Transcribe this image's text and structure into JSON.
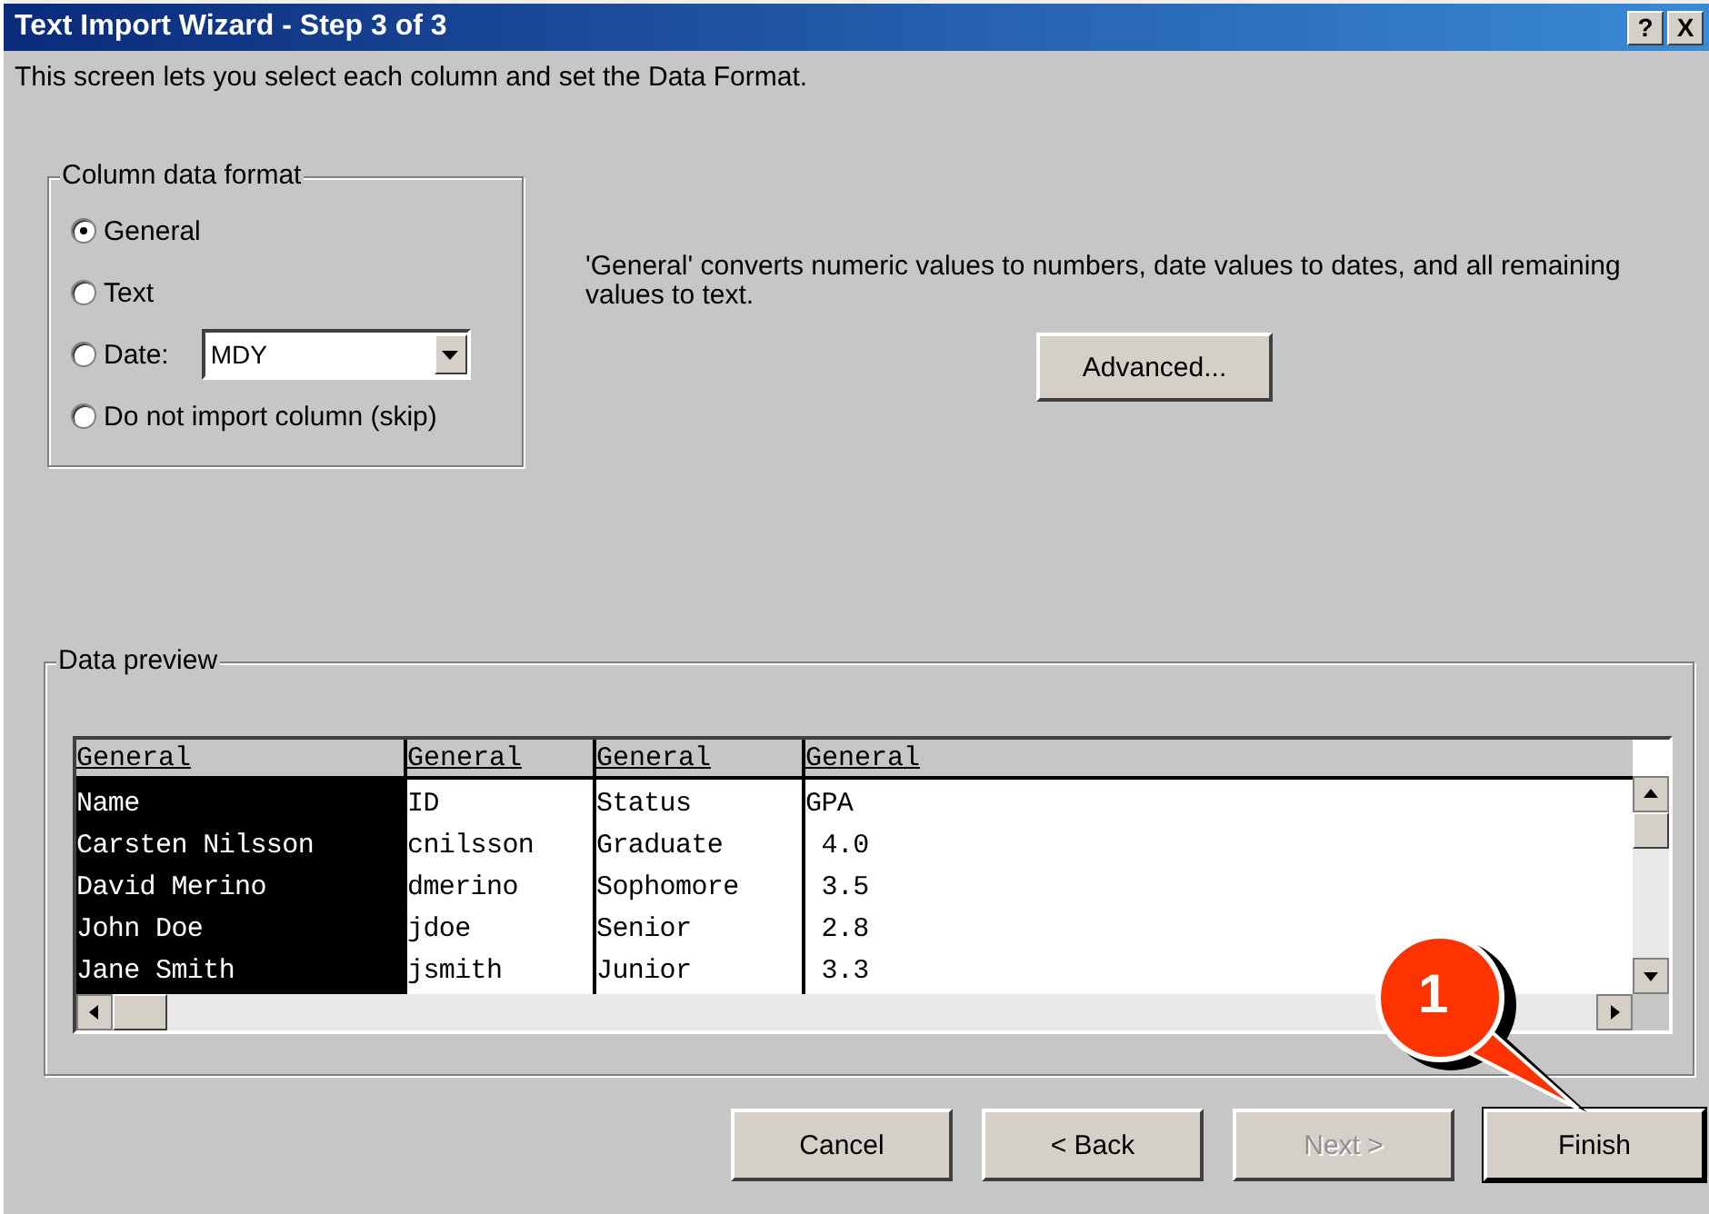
{
  "window": {
    "title": "Text Import Wizard - Step 3 of 3",
    "title_buttons": [
      "?",
      "X"
    ]
  },
  "intro": "This screen lets you select each column and set the Data Format.",
  "column_data_format": {
    "legend": "Column data format",
    "options": [
      {
        "label": "General",
        "selected": true
      },
      {
        "label": "Text",
        "selected": false
      },
      {
        "label": "Date:",
        "selected": false,
        "select_value": "MDY"
      },
      {
        "label": "Do not import column (skip)",
        "selected": false
      }
    ]
  },
  "description": "'General' converts numeric values to numbers, date values to dates, and all remaining values to text.",
  "advanced_button": "Advanced...",
  "data_preview": {
    "legend": "Data preview",
    "columns": [
      {
        "header": "General",
        "selected": true,
        "cells": [
          "Name",
          "Carsten Nilsson",
          "David Merino",
          "John Doe",
          "Jane Smith"
        ]
      },
      {
        "header": "General",
        "selected": false,
        "cells": [
          "ID",
          "cnilsson",
          "dmerino",
          "jdoe",
          "jsmith"
        ]
      },
      {
        "header": "General",
        "selected": false,
        "cells": [
          "Status",
          "Graduate",
          "Sophomore",
          "Senior",
          "Junior"
        ]
      },
      {
        "header": "General",
        "selected": false,
        "cells": [
          "GPA",
          " 4.0",
          " 3.5",
          " 2.8",
          " 3.3"
        ]
      }
    ]
  },
  "callout": "1",
  "buttons": [
    {
      "label": "Cancel",
      "disabled": false,
      "default": false
    },
    {
      "label": "< Back",
      "disabled": false,
      "default": false
    },
    {
      "label": "Next >",
      "disabled": true,
      "default": false
    },
    {
      "label": "Finish",
      "disabled": false,
      "default": true
    }
  ]
}
